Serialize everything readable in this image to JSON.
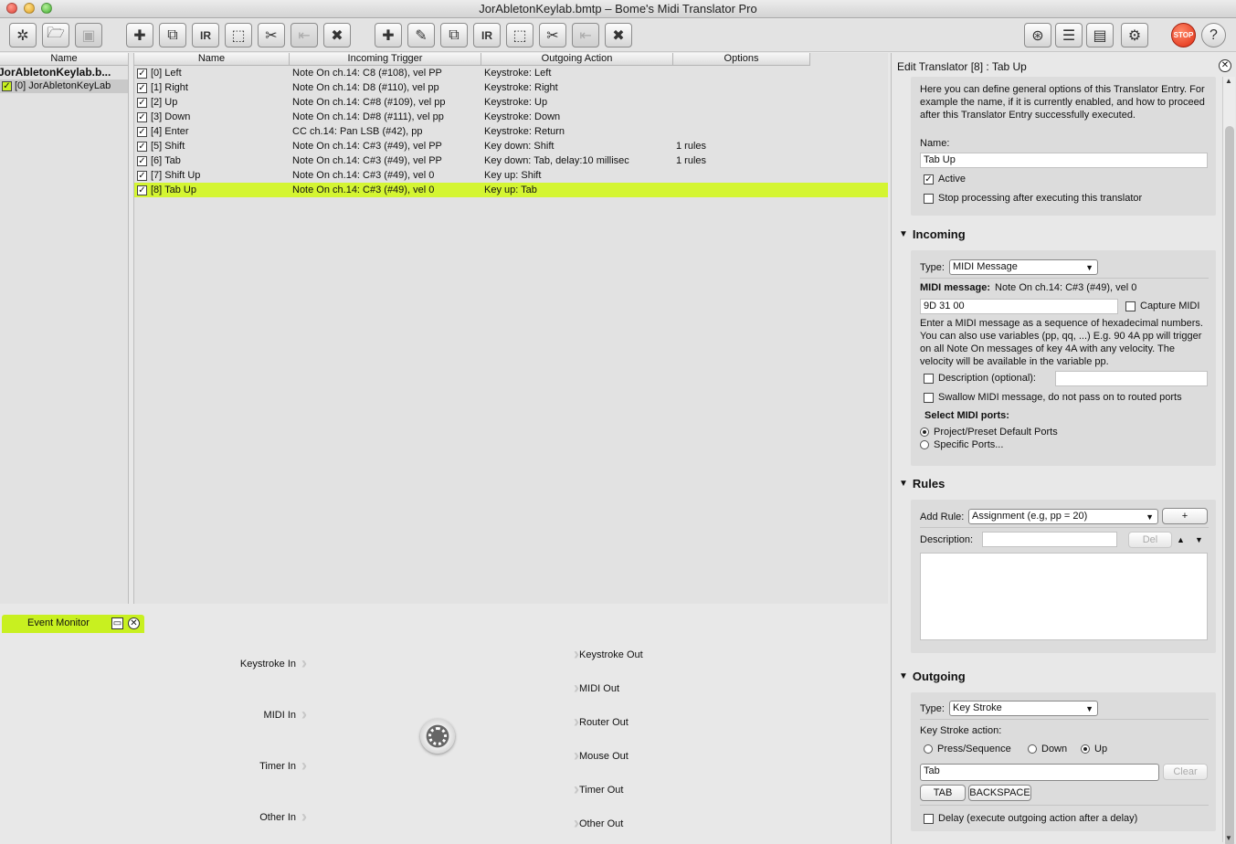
{
  "window": {
    "title": "JorAbletonKeylab.bmtp – Bome's Midi Translator Pro"
  },
  "toolbar": {
    "stop_label": "STOP"
  },
  "project": {
    "column_header": "Name",
    "project_name": "JorAbletonKeylab.b...",
    "preset": "[0] JorAbletonKeyLab"
  },
  "translators": {
    "columns": [
      "Name",
      "Incoming Trigger",
      "Outgoing Action",
      "Options"
    ],
    "rows": [
      {
        "name": "[0] Left",
        "incoming": "Note On ch.14: C8 (#108), vel PP",
        "outgoing": "Keystroke: Left",
        "options": ""
      },
      {
        "name": "[1] Right",
        "incoming": "Note On ch.14: D8 (#110), vel pp",
        "outgoing": "Keystroke: Right",
        "options": ""
      },
      {
        "name": "[2] Up",
        "incoming": "Note On ch.14: C#8 (#109), vel pp",
        "outgoing": "Keystroke: Up",
        "options": ""
      },
      {
        "name": "[3] Down",
        "incoming": "Note On ch.14: D#8 (#111), vel pp",
        "outgoing": "Keystroke: Down",
        "options": ""
      },
      {
        "name": "[4] Enter",
        "incoming": "CC ch.14: Pan LSB (#42), pp",
        "outgoing": "Keystroke: Return",
        "options": ""
      },
      {
        "name": "[5] Shift",
        "incoming": "Note On ch.14: C#3 (#49), vel PP",
        "outgoing": "Key down: Shift",
        "options": "1 rules"
      },
      {
        "name": "[6] Tab",
        "incoming": "Note On ch.14: C#3 (#49), vel PP",
        "outgoing": "Key down: Tab, delay:10 millisec",
        "options": "1 rules"
      },
      {
        "name": "[7] Shift Up",
        "incoming": "Note On ch.14: C#3 (#49), vel 0",
        "outgoing": "Key up: Shift",
        "options": ""
      },
      {
        "name": "[8] Tab Up",
        "incoming": "Note On ch.14: C#3 (#49), vel 0",
        "outgoing": "Key up: Tab",
        "options": ""
      }
    ]
  },
  "event_monitor": {
    "title": "Event Monitor",
    "inputs": [
      "Keystroke In",
      "MIDI In",
      "Timer In",
      "Other In"
    ],
    "outputs": [
      "Keystroke Out",
      "MIDI Out",
      "Router Out",
      "Mouse Out",
      "Timer Out",
      "Other Out"
    ]
  },
  "edit": {
    "header": "Edit Translator [8] : Tab Up",
    "general": {
      "description": "Here you can define general options of this Translator Entry. For example the name, if it is currently enabled, and how to proceed after this Translator Entry successfully executed.",
      "name_label": "Name:",
      "name_value": "Tab Up",
      "active_label": "Active",
      "stop_label": "Stop processing after executing this translator"
    },
    "incoming": {
      "title": "Incoming",
      "type_label": "Type:",
      "type_value": "MIDI Message",
      "midi_message_label": "MIDI message:",
      "midi_message_value": "Note On ch.14: C#3 (#49), vel 0",
      "hex_value": "9D 31 00",
      "capture_label": "Capture MIDI",
      "help": "Enter a MIDI message as a sequence of hexadecimal numbers. You can also use variables (pp, qq, ...) E.g. 90 4A pp will trigger on all Note On messages of key 4A with any velocity. The velocity will be available in the variable pp.",
      "description_label": "Description (optional):",
      "swallow_label": "Swallow MIDI message, do not pass on to routed ports",
      "ports_label": "Select MIDI ports:",
      "port_default": "Project/Preset Default Ports",
      "port_specific": "Specific Ports..."
    },
    "rules": {
      "title": "Rules",
      "add_label": "Add Rule:",
      "add_value": "Assignment (e.g, pp = 20)",
      "plus": "+",
      "description_label": "Description:",
      "del": "Del"
    },
    "outgoing": {
      "title": "Outgoing",
      "type_label": "Type:",
      "type_value": "Key Stroke",
      "action_label": "Key Stroke action:",
      "press": "Press/Sequence",
      "down": "Down",
      "up": "Up",
      "key_value": "Tab",
      "clear": "Clear",
      "tab_btn": "TAB",
      "backspace_btn": "BACKSPACE",
      "delay_label": "Delay (execute outgoing action after a delay)"
    }
  }
}
